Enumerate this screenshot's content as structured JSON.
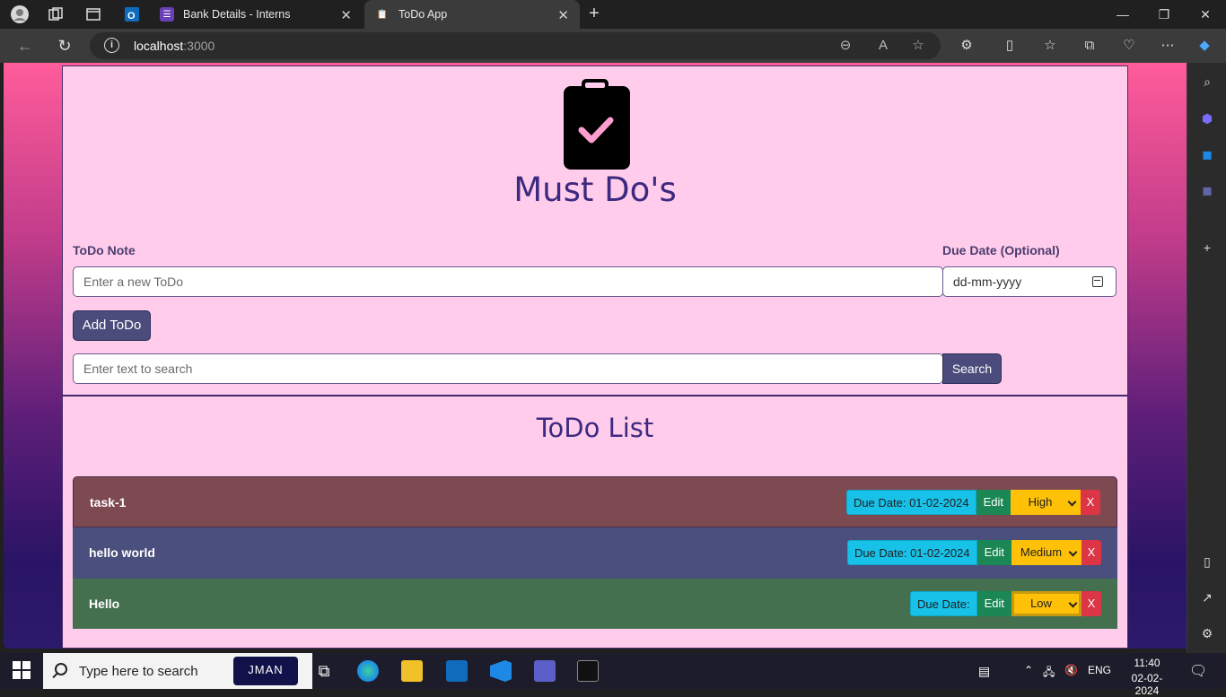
{
  "browser": {
    "tabs": [
      {
        "label": "Bank Details - Interns"
      },
      {
        "label": "ToDo App"
      }
    ],
    "url_host": "localhost",
    "url_port": ":3000"
  },
  "app": {
    "title": "Must Do's",
    "todo_note_label": "ToDo Note",
    "due_date_label": "Due Date (Optional)",
    "note_placeholder": "Enter a new ToDo",
    "date_placeholder": "dd-mm-yyyy",
    "add_button": "Add ToDo",
    "search_placeholder": "Enter text to search",
    "search_button": "Search",
    "list_title": "ToDo List",
    "items": [
      {
        "name": "task-1",
        "due": "Due Date: 01-02-2024",
        "edit": "Edit",
        "priority": "High",
        "delete": "X",
        "color": "#7d4a52"
      },
      {
        "name": "hello world",
        "due": "Due Date: 01-02-2024",
        "edit": "Edit",
        "priority": "Medium",
        "delete": "X",
        "color": "#4b4f7d"
      },
      {
        "name": "Hello",
        "due": "Due Date:",
        "edit": "Edit",
        "priority": "Low",
        "delete": "X",
        "color": "#447050"
      }
    ]
  },
  "taskbar": {
    "search_text": "Type here to search",
    "jman": "JMAN",
    "lang": "ENG",
    "time": "11:40",
    "date": "02-02-2024"
  }
}
